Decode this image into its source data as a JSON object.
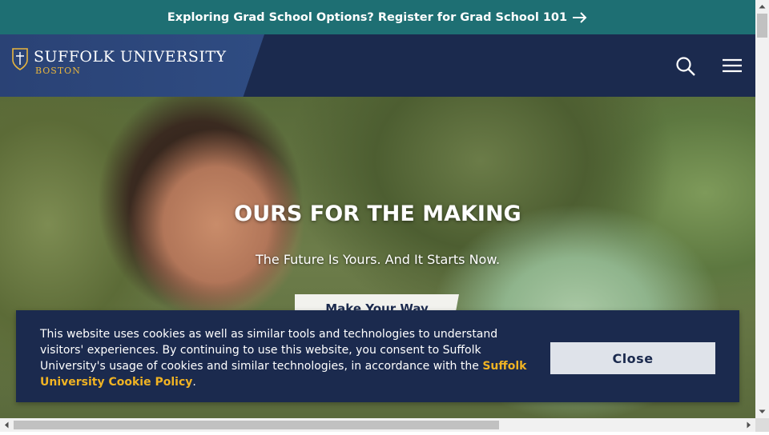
{
  "promo": {
    "text": "Exploring Grad School Options? Register for Grad School 101"
  },
  "header": {
    "logo_title": "SUFFOLK UNIVERSITY",
    "logo_sub": "BOSTON",
    "search_icon": "search-icon",
    "menu_icon": "hamburger-menu-icon"
  },
  "hero": {
    "headline": "OURS FOR THE MAKING",
    "subheadline": "The Future Is Yours. And It Starts Now.",
    "cta_label": "Make Your Way"
  },
  "cookie_banner": {
    "text": "This website uses cookies as well as similar tools and technologies to understand visitors' experiences. By continuing to use this website, you consent to Suffolk University's usage of cookies and similar technologies, in accordance with the ",
    "link_text": "Suffolk University Cookie Policy",
    "text_end": ".",
    "close_label": "Close"
  },
  "colors": {
    "promo_bg": "#1e6f73",
    "navy": "#1b2a4e",
    "gold": "#e8b53d",
    "link_gold": "#f0b323"
  }
}
